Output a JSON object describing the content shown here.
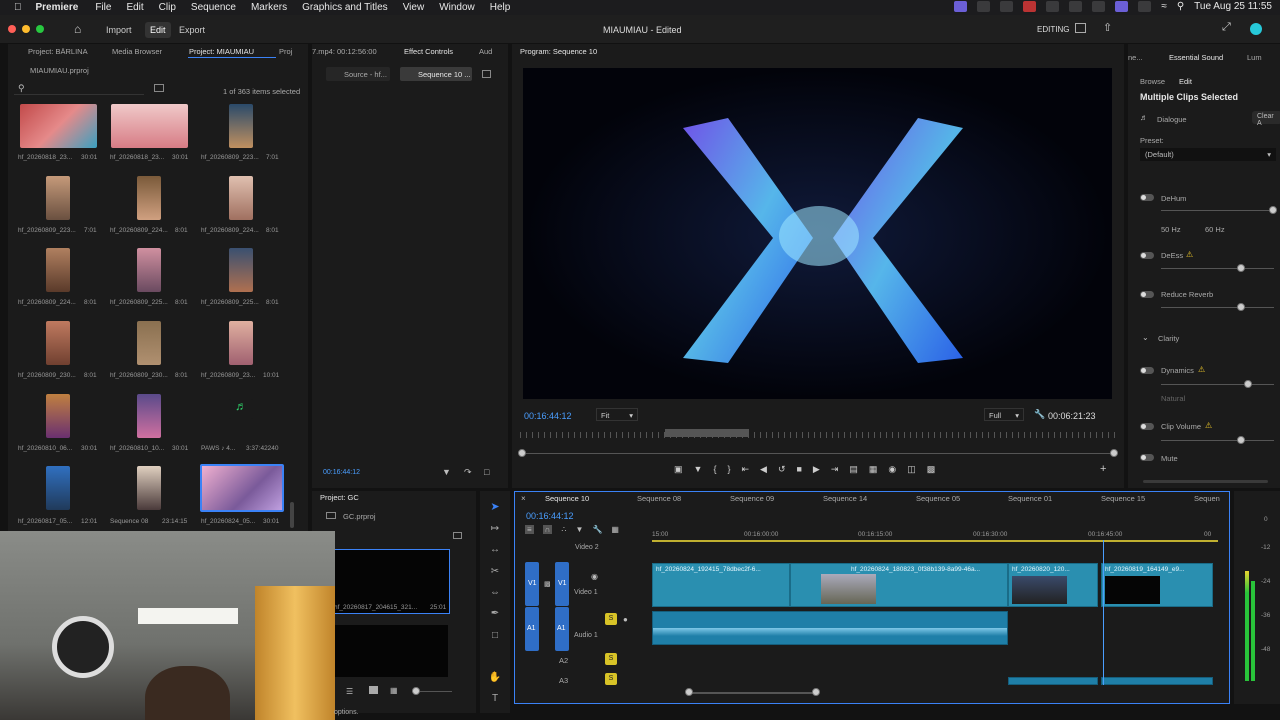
{
  "menubar": {
    "app": "Premiere",
    "items": [
      "File",
      "Edit",
      "Clip",
      "Sequence",
      "Markers",
      "Graphics and Titles",
      "View",
      "Window",
      "Help"
    ],
    "clock": "Tue Aug 25  11:55"
  },
  "appbar": {
    "tabs": [
      "Import",
      "Edit",
      "Export"
    ],
    "active": "Edit",
    "title": "MIAUMIAU - Edited",
    "workspace": "EDITING"
  },
  "project_panel": {
    "tabs": [
      "Project: BÄRLINA",
      "Media Browser",
      "Project: MIAUMIAU",
      "Proj"
    ],
    "file": "MIAUMIAU.prproj",
    "selected_info": "1 of 363 items selected",
    "items": [
      {
        "name": "hf_20260818_23...",
        "dur": "30:01"
      },
      {
        "name": "hf_20260818_23...",
        "dur": "30:01"
      },
      {
        "name": "hf_20260809_223...",
        "dur": "7:01"
      },
      {
        "name": "hf_20260809_223...",
        "dur": "7:01"
      },
      {
        "name": "hf_20260809_224...",
        "dur": "8:01"
      },
      {
        "name": "hf_20260809_224...",
        "dur": "8:01"
      },
      {
        "name": "hf_20260809_224...",
        "dur": "8:01"
      },
      {
        "name": "hf_20260809_225...",
        "dur": "8:01"
      },
      {
        "name": "hf_20260809_225...",
        "dur": "8:01"
      },
      {
        "name": "hf_20260809_230...",
        "dur": "8:01"
      },
      {
        "name": "hf_20260809_230...",
        "dur": "8:01"
      },
      {
        "name": "hf_20260809_23...",
        "dur": "10:01"
      },
      {
        "name": "hf_20260810_06...",
        "dur": "30:01"
      },
      {
        "name": "hf_20260810_10...",
        "dur": "30:01"
      },
      {
        "name": "PAWS ♪ 4...",
        "dur": "3:37:42240"
      },
      {
        "name": "hf_20260817_05...",
        "dur": "12:01"
      },
      {
        "name": "Sequence 08",
        "dur": "23:14:15"
      },
      {
        "name": "hf_20260824_05...",
        "dur": "30:01"
      }
    ]
  },
  "effect_controls": {
    "tabs": [
      "7.mp4: 00:12:56:00",
      "Effect Controls",
      "Aud"
    ],
    "source_tab": "Source - hf...",
    "seq_tab": "Sequence 10 ...",
    "timecode": "00:16:44:12"
  },
  "program": {
    "title": "Program: Sequence 10",
    "timecode": "00:16:44:12",
    "fit": "Fit",
    "quality": "Full",
    "duration": "00:06:21:23"
  },
  "essential_sound": {
    "tabs": [
      "ne...",
      "Essential Sound",
      "Lum"
    ],
    "subtabs": [
      "Browse",
      "Edit"
    ],
    "heading": "Multiple Clips Selected",
    "dialogue": "Dialogue",
    "clear": "Clear A",
    "preset_label": "Preset:",
    "preset_value": "(Default)",
    "dehum": "DeHum",
    "hz50": "50 Hz",
    "hz60": "60 Hz",
    "deess": "DeEss",
    "reverb": "Reduce Reverb",
    "clarity": "Clarity",
    "dynamics": "Dynamics",
    "natural": "Natural",
    "clip_volume": "Clip Volume",
    "mute": "Mute"
  },
  "project_gc": {
    "title": "Project: GC",
    "file": "GC.prproj",
    "item": "hf_20260817_204615_321...",
    "item_dur": "25:01"
  },
  "timeline": {
    "tabs": [
      "Sequence 10",
      "Sequence 08",
      "Sequence 09",
      "Sequence 14",
      "Sequence 05",
      "Sequence 01",
      "Sequence 15",
      "Sequen"
    ],
    "timecode": "00:16:44:12",
    "ruler": [
      "15:00",
      "00:16:00:00",
      "00:16:15:00",
      "00:16:30:00",
      "00:16:45:00",
      "00"
    ],
    "tracks": {
      "v2": "Video 2",
      "v1": "Video 1",
      "a1": "Audio 1",
      "a2": "A2",
      "a3": "A3"
    },
    "clips": [
      "hf_20260824_192415_78dbec2f-6...",
      "hf_20260824_180823_0f38b139-8a99-46a...",
      "hf_20260820_120...",
      "hf_20260819_164149_e9..."
    ],
    "meter_labels": [
      "0",
      "-12",
      "-24",
      "-36",
      "-48"
    ]
  },
  "status": "options."
}
